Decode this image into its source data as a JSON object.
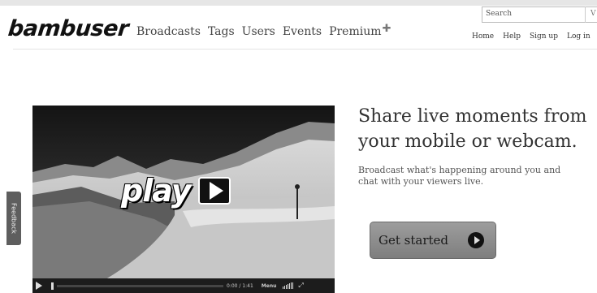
{
  "header": {
    "logo_text": "bambuser",
    "main_nav": [
      "Broadcasts",
      "Tags",
      "Users",
      "Events",
      "Premium"
    ],
    "premium_icon": "plus-icon",
    "search_placeholder": "Search",
    "search_button_fragment": "V",
    "util_nav": [
      "Home",
      "Help",
      "Sign up",
      "Log in"
    ]
  },
  "feedback": {
    "label": "Feedback"
  },
  "video": {
    "overlay_word": "play",
    "time": "0:00 / 1:41",
    "menu_label": "Menu",
    "icons": [
      "play-icon",
      "volume-icon",
      "fullscreen-icon"
    ]
  },
  "hero": {
    "headline_line1": "Share live moments from",
    "headline_line2": "your mobile or webcam.",
    "subtext_line1": "Broadcast what's happening around you and",
    "subtext_line2": "chat with your viewers live.",
    "cta_label": "Get started"
  },
  "colors": {
    "background": "#ffffff",
    "cta_background": "#8c8c8c",
    "video_background": "#2d2d2d",
    "feedback_tab": "#5e5e5e"
  }
}
